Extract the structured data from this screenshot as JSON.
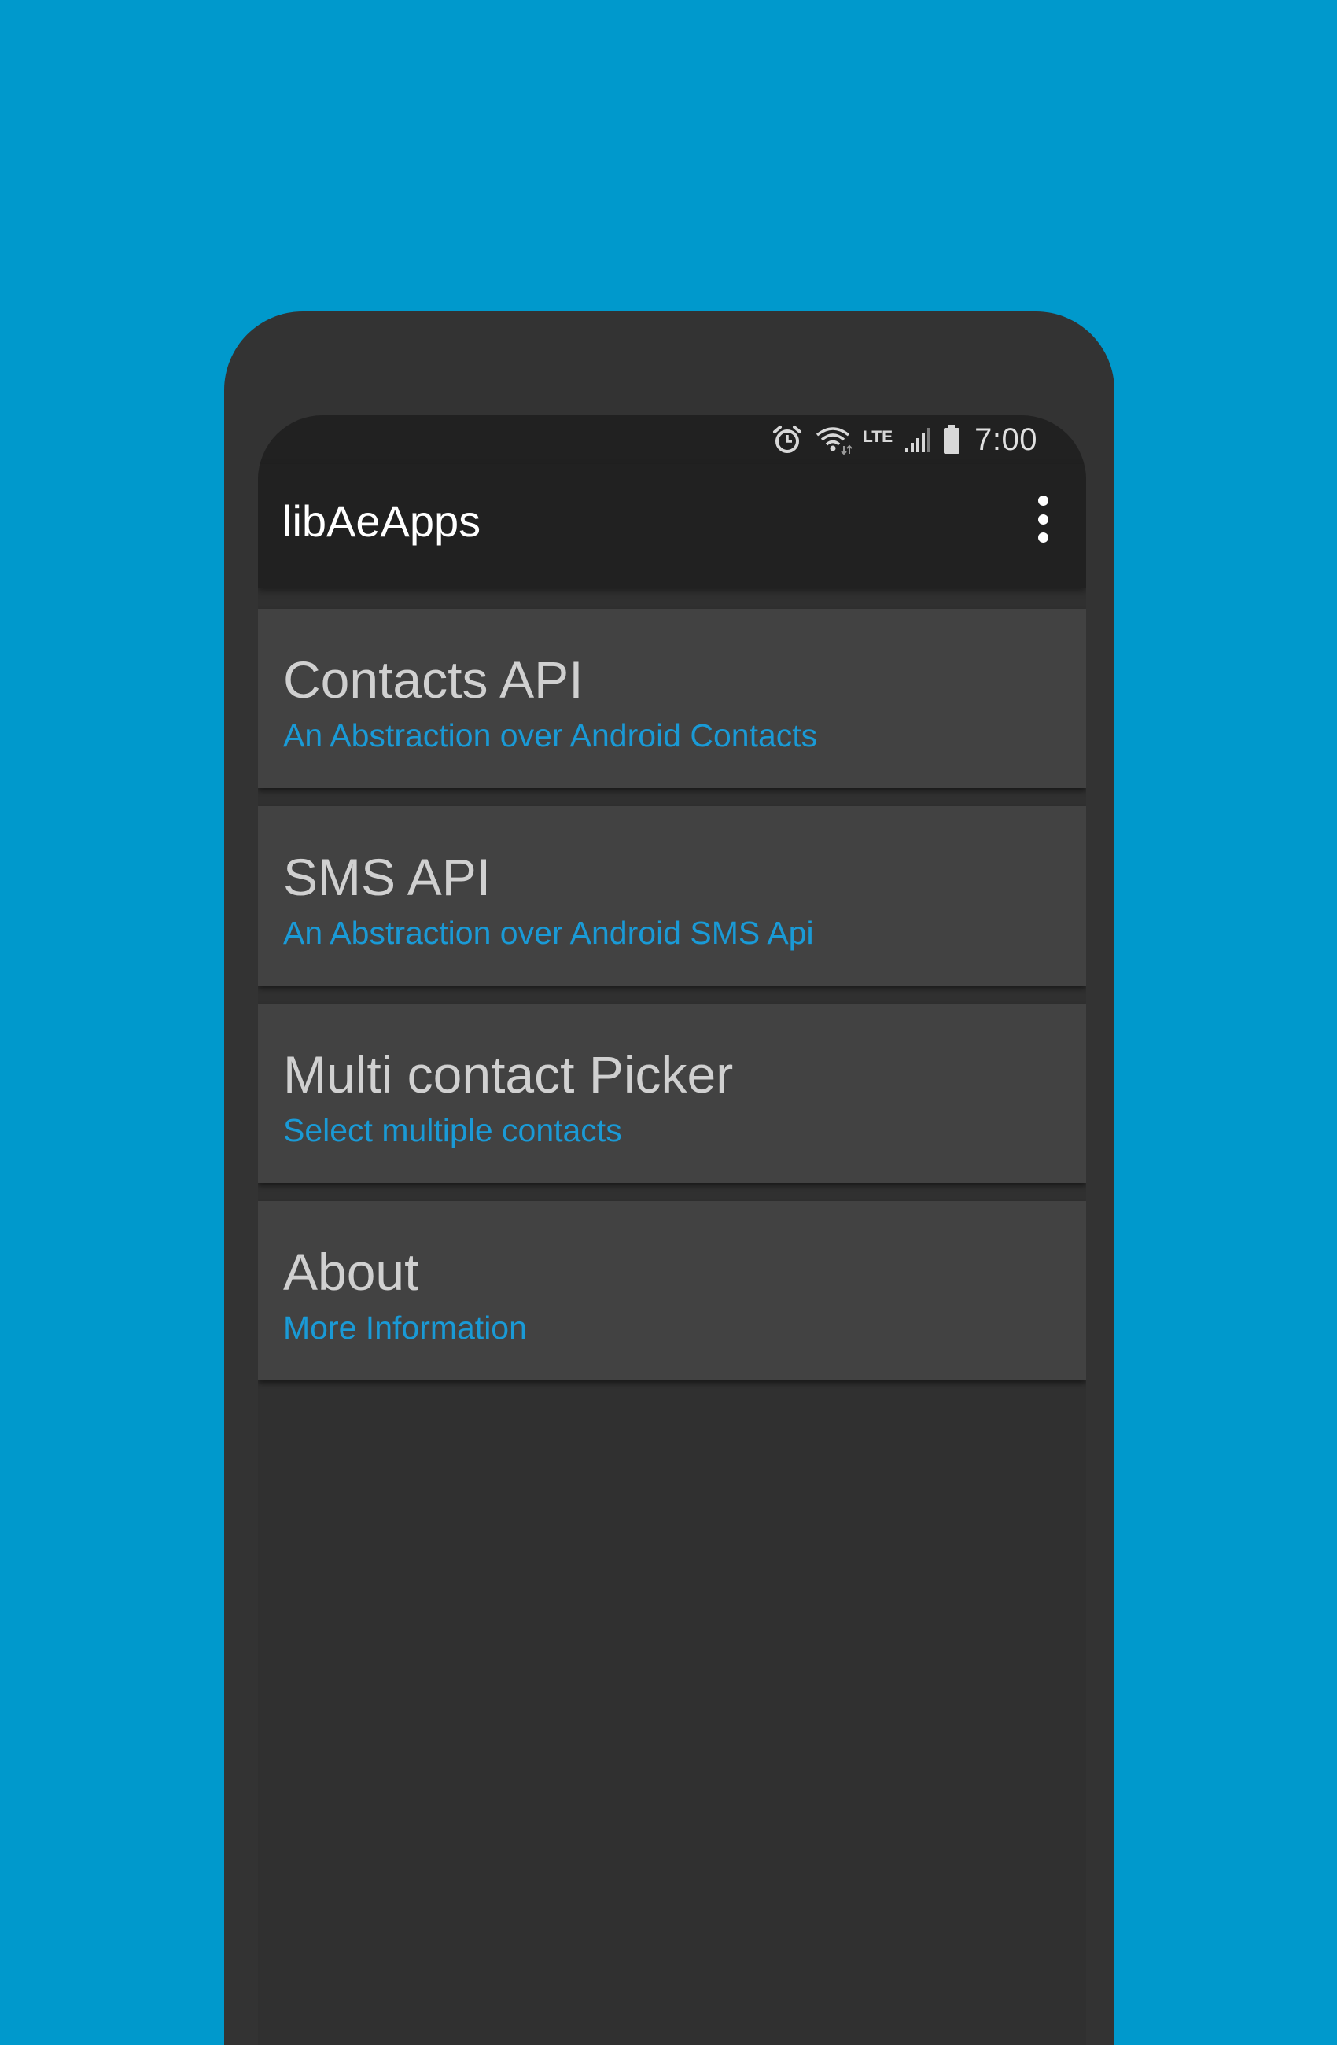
{
  "colors": {
    "background": "#0099cc",
    "phone_frame": "#333333",
    "app_bar": "#212121",
    "screen_background": "#303030",
    "card_background": "#424242",
    "title_text": "#d0d0d0",
    "accent_text": "#1a9ad6"
  },
  "status_bar": {
    "time": "7:00",
    "network_label": "LTE",
    "icons": [
      "alarm-icon",
      "wifi-icon",
      "lte-icon",
      "cell-signal-icon",
      "battery-icon"
    ]
  },
  "app_bar": {
    "title": "libAeApps",
    "overflow_icon": "more-vert-icon"
  },
  "cards": [
    {
      "title": "Contacts API",
      "subtitle": "An Abstraction over Android Contacts"
    },
    {
      "title": "SMS API",
      "subtitle": "An Abstraction over Android SMS Api"
    },
    {
      "title": "Multi contact Picker",
      "subtitle": "Select multiple contacts"
    },
    {
      "title": "About",
      "subtitle": "More Information"
    }
  ]
}
